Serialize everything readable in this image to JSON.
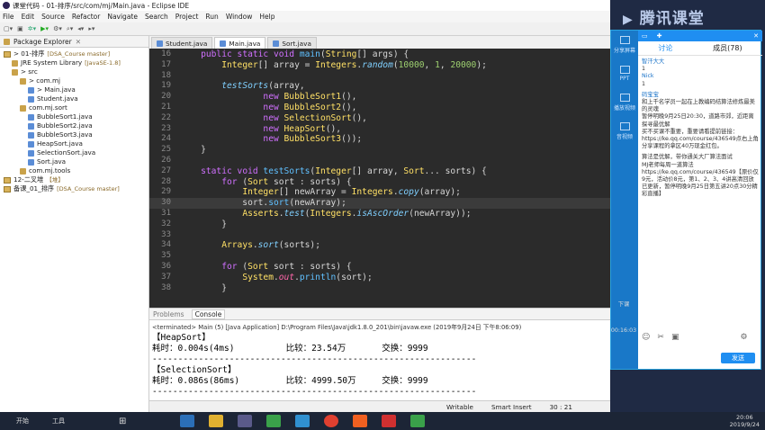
{
  "window": {
    "title": "课堂代码 - 01-排序/src/com/mj/Main.java - Eclipse IDE"
  },
  "menu": [
    "File",
    "Edit",
    "Source",
    "Refactor",
    "Navigate",
    "Search",
    "Project",
    "Run",
    "Window",
    "Help"
  ],
  "explorer": {
    "title": "Package Explorer",
    "tree": [
      {
        "label": "> 01-排序",
        "dec": "[DSA_Course master]",
        "kind": "proj",
        "indent": 0
      },
      {
        "label": "JRE System Library",
        "dec": "[JavaSE-1.8]",
        "kind": "lib",
        "indent": 1
      },
      {
        "label": "> src",
        "dec": "",
        "kind": "folder",
        "indent": 1
      },
      {
        "label": "> com.mj",
        "dec": "",
        "kind": "pkg",
        "indent": 2
      },
      {
        "label": "> Main.java",
        "dec": "",
        "kind": "file",
        "indent": 3
      },
      {
        "label": "Student.java",
        "dec": "",
        "kind": "file",
        "indent": 3
      },
      {
        "label": "com.mj.sort",
        "dec": "",
        "kind": "pkg",
        "indent": 2
      },
      {
        "label": "BubbleSort1.java",
        "dec": "",
        "kind": "file",
        "indent": 3
      },
      {
        "label": "BubbleSort2.java",
        "dec": "",
        "kind": "file",
        "indent": 3
      },
      {
        "label": "BubbleSort3.java",
        "dec": "",
        "kind": "file",
        "indent": 3
      },
      {
        "label": "HeapSort.java",
        "dec": "",
        "kind": "file",
        "indent": 3
      },
      {
        "label": "SelectionSort.java",
        "dec": "",
        "kind": "file",
        "indent": 3
      },
      {
        "label": "Sort.java",
        "dec": "",
        "kind": "file",
        "indent": 3
      },
      {
        "label": "com.mj.tools",
        "dec": "",
        "kind": "pkg",
        "indent": 2
      },
      {
        "label": "12-二叉堆",
        "dec": "【堆】",
        "kind": "proj",
        "indent": 0
      },
      {
        "label": "备课_01_排序",
        "dec": "[DSA_Course master]",
        "kind": "proj",
        "indent": 0
      }
    ]
  },
  "tabs": [
    {
      "label": "Student.java",
      "active": false
    },
    {
      "label": "Main.java",
      "active": true
    },
    {
      "label": "Sort.java",
      "active": false
    }
  ],
  "code": [
    {
      "n": "16",
      "parts": [
        [
          "    ",
          ""
        ],
        [
          "public static void ",
          "kw"
        ],
        [
          "main",
          "fn"
        ],
        [
          "(",
          ""
        ],
        [
          "String",
          "ty"
        ],
        [
          "[] args) {",
          ""
        ]
      ]
    },
    {
      "n": "17",
      "parts": [
        [
          "        ",
          ""
        ],
        [
          "Integer",
          "ty"
        ],
        [
          "[] array = ",
          ""
        ],
        [
          "Integers",
          "ty"
        ],
        [
          ".",
          ""
        ],
        [
          "random",
          "it"
        ],
        [
          "(",
          ""
        ],
        [
          "10000",
          "nm"
        ],
        [
          ", ",
          ""
        ],
        [
          "1",
          "nm"
        ],
        [
          ", ",
          ""
        ],
        [
          "20000",
          "nm"
        ],
        [
          ");",
          ""
        ]
      ]
    },
    {
      "n": "18",
      "parts": []
    },
    {
      "n": "19",
      "parts": [
        [
          "        ",
          ""
        ],
        [
          "testSorts",
          "it"
        ],
        [
          "(array,",
          ""
        ]
      ]
    },
    {
      "n": "20",
      "parts": [
        [
          "                ",
          ""
        ],
        [
          "new ",
          "kw"
        ],
        [
          "BubbleSort1",
          "ty"
        ],
        [
          "(),",
          ""
        ]
      ]
    },
    {
      "n": "21",
      "parts": [
        [
          "                ",
          ""
        ],
        [
          "new ",
          "kw"
        ],
        [
          "BubbleSort2",
          "ty"
        ],
        [
          "(),",
          ""
        ]
      ]
    },
    {
      "n": "22",
      "parts": [
        [
          "                ",
          ""
        ],
        [
          "new ",
          "kw"
        ],
        [
          "SelectionSort",
          "ty"
        ],
        [
          "(),",
          ""
        ]
      ]
    },
    {
      "n": "23",
      "parts": [
        [
          "                ",
          ""
        ],
        [
          "new ",
          "kw"
        ],
        [
          "HeapSort",
          "ty"
        ],
        [
          "(),",
          ""
        ]
      ]
    },
    {
      "n": "24",
      "parts": [
        [
          "                ",
          ""
        ],
        [
          "new ",
          "kw"
        ],
        [
          "BubbleSort3",
          "ty"
        ],
        [
          "());",
          ""
        ]
      ]
    },
    {
      "n": "25",
      "parts": [
        [
          "    }",
          ""
        ]
      ]
    },
    {
      "n": "26",
      "parts": []
    },
    {
      "n": "27",
      "parts": [
        [
          "    ",
          ""
        ],
        [
          "static void ",
          "kw"
        ],
        [
          "testSorts",
          "fn"
        ],
        [
          "(",
          ""
        ],
        [
          "Integer",
          "ty"
        ],
        [
          "[] array, ",
          ""
        ],
        [
          "Sort",
          "ty"
        ],
        [
          "... sorts) {",
          ""
        ]
      ]
    },
    {
      "n": "28",
      "parts": [
        [
          "        ",
          ""
        ],
        [
          "for ",
          "kw"
        ],
        [
          "(",
          ""
        ],
        [
          "Sort",
          "ty"
        ],
        [
          " sort : sorts) {",
          ""
        ]
      ]
    },
    {
      "n": "29",
      "parts": [
        [
          "            ",
          ""
        ],
        [
          "Integer",
          "ty"
        ],
        [
          "[] newArray = ",
          ""
        ],
        [
          "Integers",
          "ty"
        ],
        [
          ".",
          ""
        ],
        [
          "copy",
          "it"
        ],
        [
          "(array);",
          ""
        ]
      ]
    },
    {
      "n": "30",
      "parts": [
        [
          "            sort.",
          ""
        ],
        [
          "sort",
          "fn"
        ],
        [
          "(newArray);",
          ""
        ]
      ],
      "cur": true
    },
    {
      "n": "31",
      "parts": [
        [
          "            ",
          ""
        ],
        [
          "Asserts",
          "ty"
        ],
        [
          ".",
          ""
        ],
        [
          "test",
          "it"
        ],
        [
          "(",
          ""
        ],
        [
          "Integers",
          "ty"
        ],
        [
          ".",
          ""
        ],
        [
          "isAscOrder",
          "it"
        ],
        [
          "(newArray));",
          ""
        ]
      ]
    },
    {
      "n": "32",
      "parts": [
        [
          "        }",
          ""
        ]
      ]
    },
    {
      "n": "33",
      "parts": []
    },
    {
      "n": "34",
      "parts": [
        [
          "        ",
          ""
        ],
        [
          "Arrays",
          "ty"
        ],
        [
          ".",
          ""
        ],
        [
          "sort",
          "it"
        ],
        [
          "(sorts);",
          ""
        ]
      ]
    },
    {
      "n": "35",
      "parts": []
    },
    {
      "n": "36",
      "parts": [
        [
          "        ",
          ""
        ],
        [
          "for ",
          "kw"
        ],
        [
          "(",
          ""
        ],
        [
          "Sort",
          "ty"
        ],
        [
          " sort : sorts) {",
          ""
        ]
      ]
    },
    {
      "n": "37",
      "parts": [
        [
          "            ",
          ""
        ],
        [
          "System",
          "ty"
        ],
        [
          ".",
          ""
        ],
        [
          "out",
          "fl"
        ],
        [
          ".",
          ""
        ],
        [
          "println",
          "fn"
        ],
        [
          "(sort);",
          ""
        ]
      ]
    },
    {
      "n": "38",
      "parts": [
        [
          "        }",
          ""
        ]
      ]
    }
  ],
  "console": {
    "tabs": [
      "Problems",
      "Console"
    ],
    "terminated": "<terminated> Main (5) [Java Application] D:\\Program Files\\Java\\jdk1.8.0_201\\bin\\javaw.exe (2019年9月24日 下午8:06:09)",
    "lines": [
      "【HeapSort】",
      "耗时：0.004s(4ms)          比较：23.54万       交换：9999",
      "---------------------------------------------------------------",
      "【SelectionSort】",
      "耗时：0.086s(86ms)         比较：4999.50万     交换：9999",
      "---------------------------------------------------------------"
    ]
  },
  "status": {
    "mode": "Writable",
    "insert": "Smart Insert",
    "pos": "30 : 21"
  },
  "tencent": {
    "brand": "腾讯课堂",
    "tab_discuss": "讨论",
    "tab_members": "成员(78)",
    "time": "00:16:03",
    "send": "发送",
    "side": [
      "分享屏幕",
      "PPT",
      "播放视频",
      "音视频"
    ],
    "msgs": [
      "智汗大大",
      "1",
      "Nick",
      "1",
      "码宝宝",
      "和上千名学员一起在上教编码结算法修炼最美的灵魂",
      "暂停明晚9月25日20:30，道路市郊，近距离探寻最优解",
      "买不买课不重要，重要请看提前链接：https://ke.qq.com/course/436549点右上角分享课程的拿区40万现金红包。",
      "算法是优解，带你通关大厂算法面试",
      "MJ老师每周一道算法 https://ke.qq.com/course/436549【原价仅9元，活动价8元，第1、2、3、4讲高清回放已更新，暂停明晚9月25日第五讲20点30分精彩直播】"
    ],
    "download": "下课"
  },
  "taskbar": {
    "clock_time": "20:06",
    "clock_date": "2019/9/24",
    "left": [
      "开始",
      "工具"
    ]
  }
}
